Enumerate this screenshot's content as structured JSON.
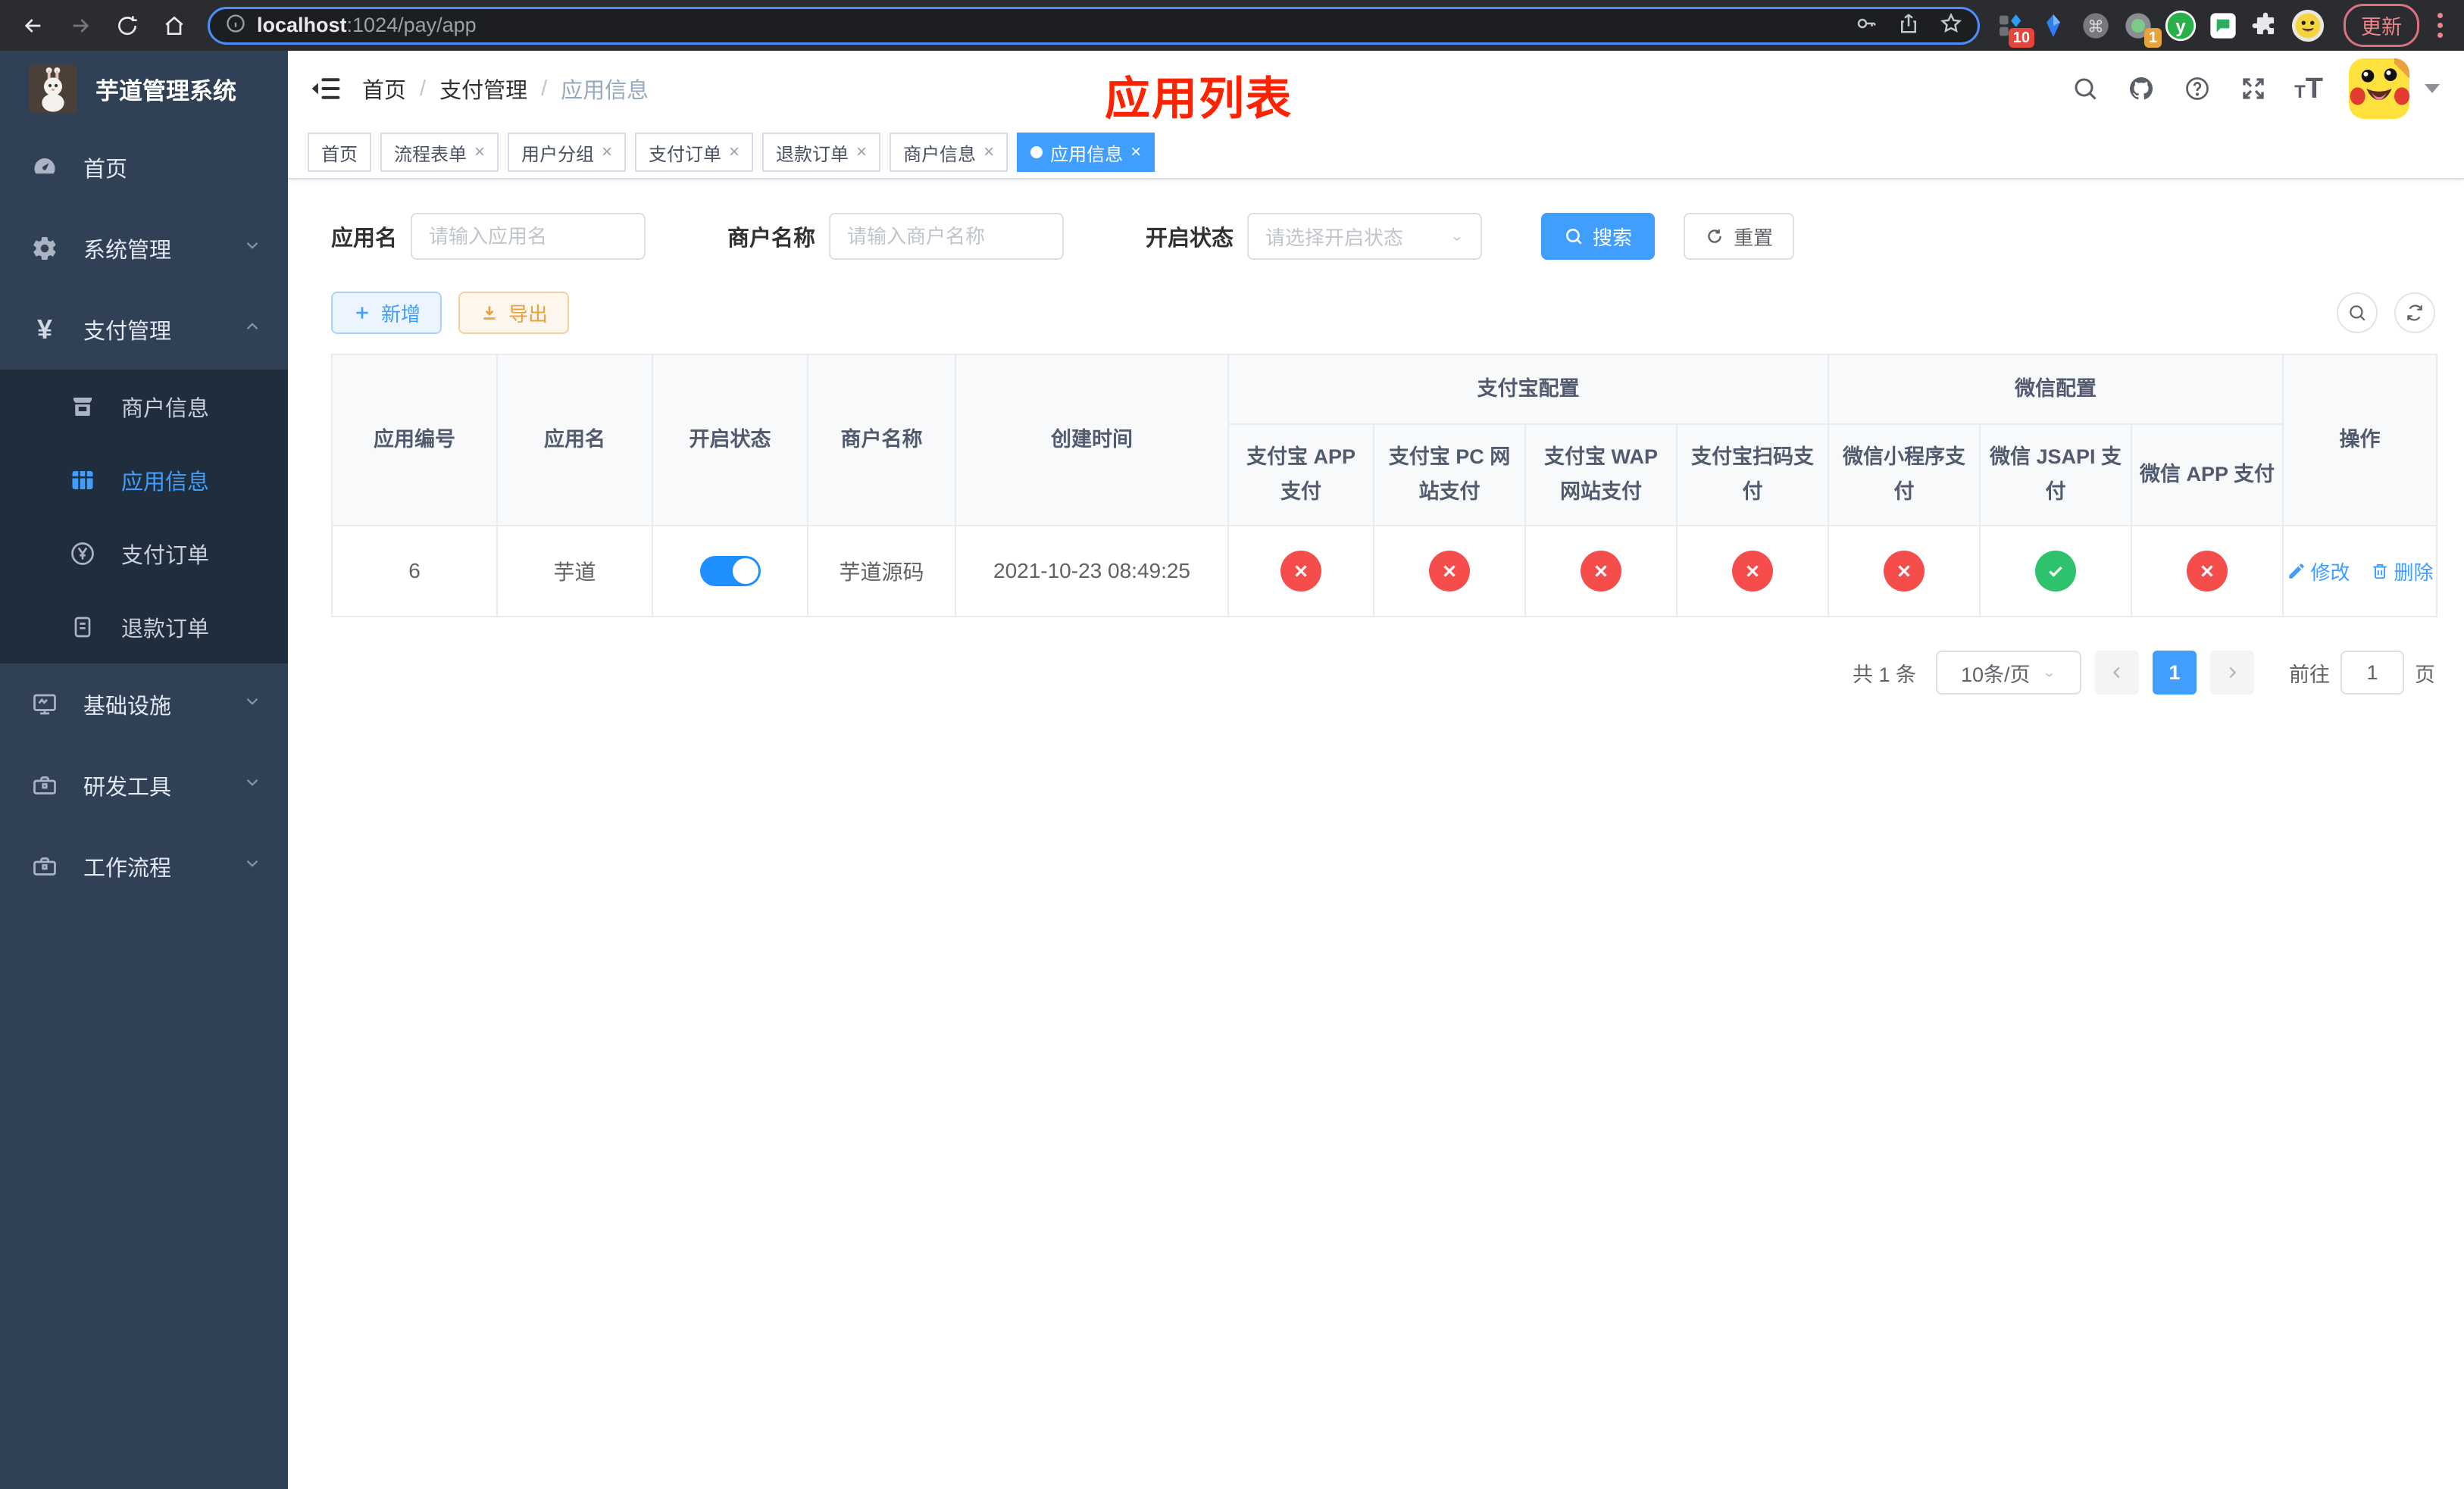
{
  "browser": {
    "url_host": "localhost",
    "url_rest": ":1024/pay/app",
    "update_label": "更新",
    "ext_badge_count": "10",
    "tab_badge_count": "1"
  },
  "sidebar": {
    "title": "芋道管理系统",
    "home": "首页",
    "system": "系统管理",
    "pay": "支付管理",
    "merchant_info": "商户信息",
    "app_info": "应用信息",
    "pay_order": "支付订单",
    "refund_order": "退款订单",
    "infra": "基础设施",
    "dev_tools": "研发工具",
    "workflow": "工作流程"
  },
  "breadcrumb": {
    "home": "首页",
    "section": "支付管理",
    "current": "应用信息"
  },
  "overlay_title": "应用列表",
  "tabs": [
    {
      "label": "首页"
    },
    {
      "label": "流程表单"
    },
    {
      "label": "用户分组"
    },
    {
      "label": "支付订单"
    },
    {
      "label": "退款订单"
    },
    {
      "label": "商户信息"
    },
    {
      "label": "应用信息"
    }
  ],
  "filters": {
    "app_name_label": "应用名",
    "app_name_placeholder": "请输入应用名",
    "merchant_label": "商户名称",
    "merchant_placeholder": "请输入商户名称",
    "status_label": "开启状态",
    "status_placeholder": "请选择开启状态",
    "search_label": "搜索",
    "reset_label": "重置"
  },
  "toolbar": {
    "add_label": "新增",
    "export_label": "导出"
  },
  "table": {
    "cols": [
      "应用编号",
      "应用名",
      "开启状态",
      "商户名称",
      "创建时间"
    ],
    "groups": [
      {
        "label": "支付宝配置",
        "children": [
          "支付宝 APP 支付",
          "支付宝 PC 网站支付",
          "支付宝 WAP 网站支付",
          "支付宝扫码支付"
        ]
      },
      {
        "label": "微信配置",
        "children": [
          "微信小程序支付",
          "微信 JSAPI 支付",
          "微信 APP 支付"
        ]
      }
    ],
    "actions_col": "操作",
    "row": {
      "id": "6",
      "name": "芋道",
      "enabled": true,
      "merchant": "芋道源码",
      "created": "2021-10-23 08:49:25",
      "statuses": [
        "fail",
        "fail",
        "fail",
        "fail",
        "fail",
        "ok",
        "fail"
      ],
      "edit_label": "修改",
      "delete_label": "删除"
    }
  },
  "pagination": {
    "total": "共 1 条",
    "page_size": "10条/页",
    "current_page": "1",
    "goto_label": "前往",
    "goto_value": "1",
    "page_unit": "页"
  },
  "colors": {
    "accent": "#409eff",
    "danger": "#f54c4c",
    "success": "#2dc26b",
    "title_red": "#ff2200"
  }
}
